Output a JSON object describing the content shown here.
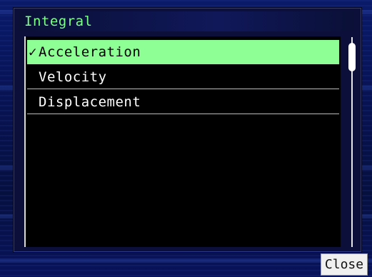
{
  "dialog": {
    "title": "Integral"
  },
  "list": {
    "items": [
      {
        "label": "Acceleration",
        "selected": true,
        "check": "✓"
      },
      {
        "label": "Velocity",
        "selected": false,
        "check": ""
      },
      {
        "label": "Displacement",
        "selected": false,
        "check": ""
      }
    ]
  },
  "footer": {
    "close_label": "Close"
  },
  "colors": {
    "title_text": "#7dff8a",
    "selection_highlight": "#8eff94",
    "background": "#0a1a6a"
  }
}
